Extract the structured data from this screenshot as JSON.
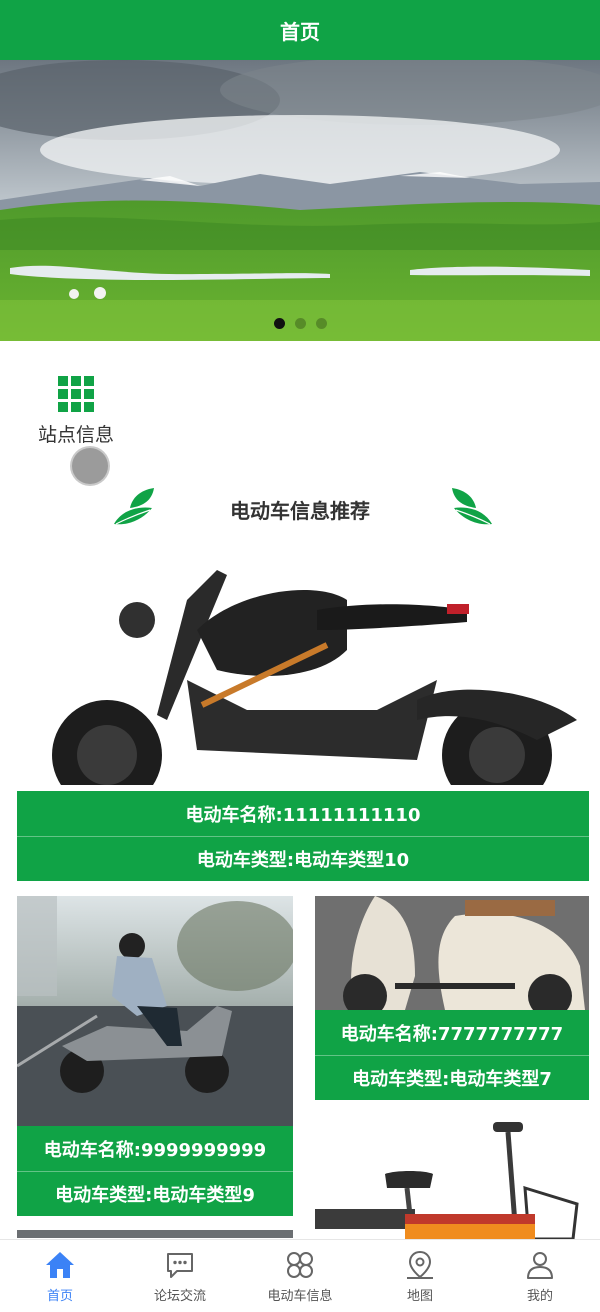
{
  "header": {
    "title": "首页"
  },
  "banner": {
    "slide_count": 3,
    "active_index": 0
  },
  "site_info": {
    "label": "站点信息",
    "icon": "grid-icon"
  },
  "section": {
    "title": "电动车信息推荐"
  },
  "cards": [
    {
      "name": "电动车名称:11111111110",
      "type": "电动车类型:电动车类型10"
    },
    {
      "name": "电动车名称:9999999999",
      "type": "电动车类型:电动车类型9"
    },
    {
      "name": "电动车名称:7777777777",
      "type": "电动车类型:电动车类型7"
    }
  ],
  "tabbar": {
    "items": [
      {
        "label": "首页",
        "icon": "home-icon",
        "active": true
      },
      {
        "label": "论坛交流",
        "icon": "chat-icon",
        "active": false
      },
      {
        "label": "电动车信息",
        "icon": "clover-icon",
        "active": false
      },
      {
        "label": "地图",
        "icon": "map-pin-icon",
        "active": false
      },
      {
        "label": "我的",
        "icon": "user-icon",
        "active": false
      }
    ]
  },
  "colors": {
    "primary": "#10a346",
    "active_tab": "#3b82f6"
  }
}
